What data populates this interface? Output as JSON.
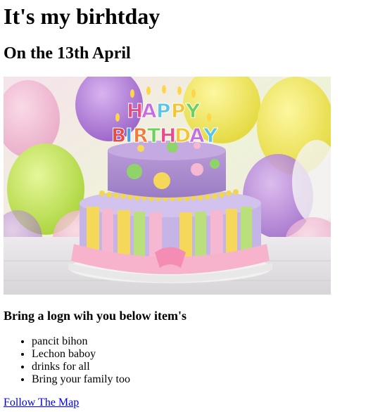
{
  "page": {
    "title": "It's my birhtday",
    "subtitle": "On the 13th April",
    "image": {
      "banner_line1": "HAPPY",
      "banner_line2": "BIRTHDAY",
      "banner_colors": [
        "#e84a8a",
        "#f5c531",
        "#59c4e8",
        "#6bd15a",
        "#c86be0",
        "#f07b3a",
        "#e84a4a",
        "#4aa0e8"
      ]
    },
    "list_heading": "Bring a logn wih you below item's",
    "items": [
      "pancit bihon",
      "Lechon baboy",
      "drinks for all",
      "Bring your family too"
    ],
    "link_text": "Follow The Map",
    "colors": {
      "link": "#0000ee"
    }
  }
}
